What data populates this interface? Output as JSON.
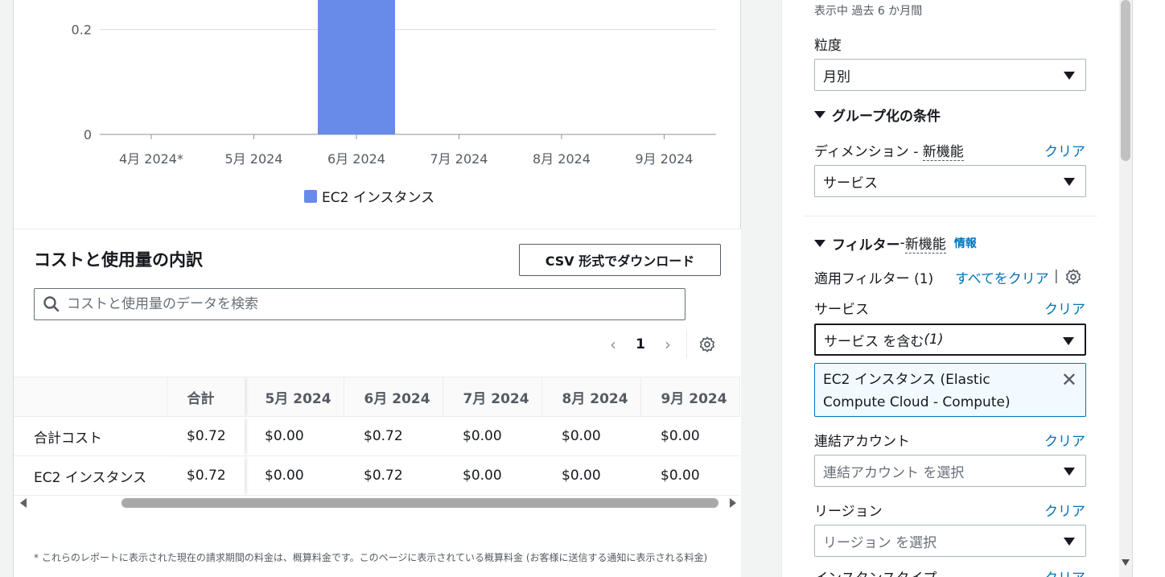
{
  "chart_data": {
    "type": "bar",
    "categories": [
      "4月 2024*",
      "5月 2024",
      "6月 2024",
      "7月 2024",
      "8月 2024",
      "9月 2024"
    ],
    "series": [
      {
        "name": "EC2 インスタンス",
        "values": [
          0,
          0,
          0.72,
          0,
          0,
          0
        ],
        "color": "#688ae8"
      }
    ],
    "y_ticks": [
      "0",
      "0.2"
    ],
    "ylim": [
      0,
      0.72
    ],
    "grid": true,
    "legend_placement": "bottom-center"
  },
  "breakdown": {
    "title": "コストと使用量の内訳",
    "csv_button": "CSV 形式でダウンロード",
    "search_placeholder": "コストと使用量のデータを検索",
    "current_page": "1",
    "columns": [
      "",
      "合計",
      "5月 2024",
      "6月 2024",
      "7月 2024",
      "8月 2024",
      "9月 2024"
    ],
    "rows": [
      [
        "合計コスト",
        "$0.72",
        "$0.00",
        "$0.72",
        "$0.00",
        "$0.00",
        "$0.00"
      ],
      [
        "EC2 インスタンス",
        "$0.72",
        "$0.00",
        "$0.72",
        "$0.00",
        "$0.00",
        "$0.00"
      ]
    ],
    "footnote": "* これらのレポートに表示された現在の請求期間の料金は、概算料金です。このページに表示されている概算料金 (お客様に送信する通知に表示される料金)"
  },
  "sidebar": {
    "period_text": "表示中 過去 6 か月間",
    "granularity_label": "粒度",
    "granularity_value": "月別",
    "group_by_heading": "グループ化の条件",
    "dimension_label": "ディメンション",
    "new_feature_sep": " - ",
    "new_feature": "新機能",
    "clear": "クリア",
    "dimension_value": "サービス",
    "filters_heading": "フィルター",
    "info": "情報",
    "applied_filters": "適用フィルター (1)",
    "clear_all": "すべてをクリア",
    "service_label": "サービス",
    "service_select_text": "サービス を含む ",
    "service_select_count": "(1)",
    "token_text": "EC2 インスタンス (Elastic Compute Cloud - Compute)",
    "linked_account_label": "連結アカウント",
    "linked_account_placeholder": "連結アカウント を選択",
    "region_label": "リージョン",
    "region_placeholder": "リージョン を選択",
    "instance_type_label": "インスタンスタイプ"
  }
}
